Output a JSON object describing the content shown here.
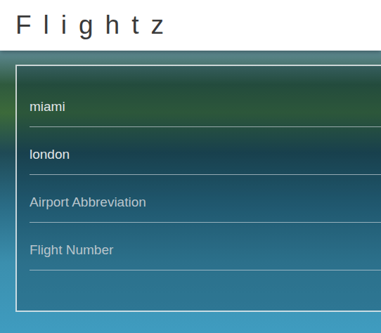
{
  "header": {
    "title": "Flightz"
  },
  "form": {
    "fields": [
      {
        "name": "origin",
        "value": "miami",
        "placeholder": ""
      },
      {
        "name": "destination",
        "value": "london",
        "placeholder": ""
      },
      {
        "name": "airport",
        "value": "",
        "placeholder": "Airport Abbreviation"
      },
      {
        "name": "flight-number",
        "value": "",
        "placeholder": "Flight Number"
      }
    ]
  }
}
